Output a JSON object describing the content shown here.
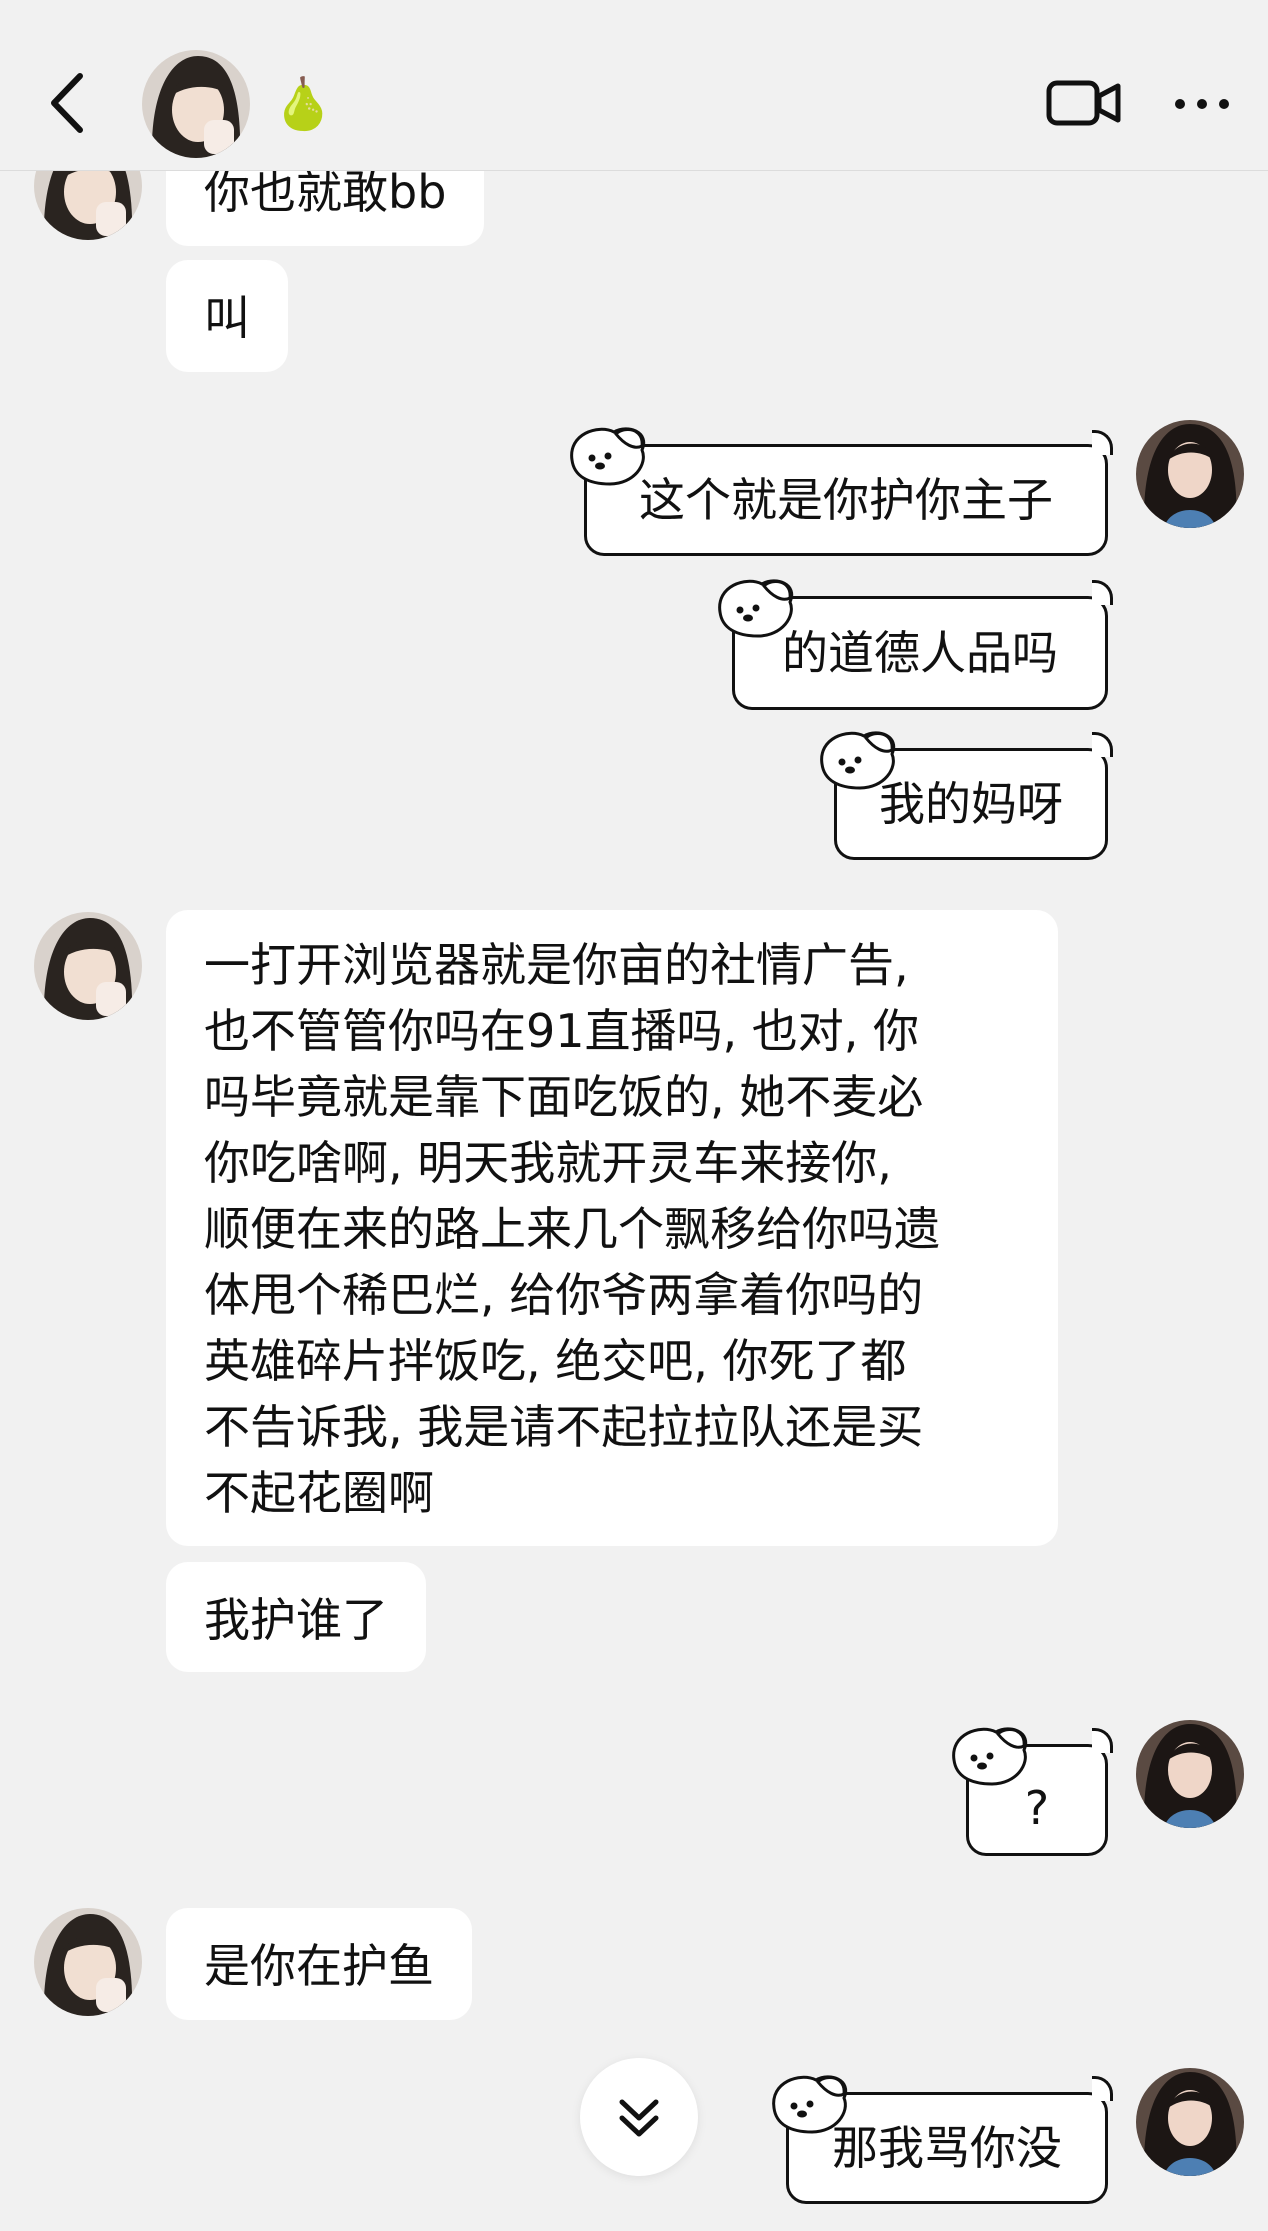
{
  "header": {
    "back_icon": "chevron-left-icon",
    "contact_emoji": "🍐",
    "video_icon": "video-camera-icon",
    "more_icon": "more-dots-icon"
  },
  "messages": [
    {
      "side": "in",
      "text": "你也就敢bb"
    },
    {
      "side": "in",
      "text": "叫"
    },
    {
      "side": "out",
      "text": "这个就是你护你主子"
    },
    {
      "side": "out",
      "text": "的道德人品吗"
    },
    {
      "side": "out",
      "text": "我的妈呀"
    },
    {
      "side": "in",
      "lines": [
        "一打开浏览器就是你亩的社情广告,",
        "也不管管你吗在91直播吗, 也对, 你",
        "吗毕竟就是靠下面吃饭的, 她不麦必",
        "你吃啥啊, 明天我就开灵车来接你,",
        "顺便在来的路上来几个飘移给你吗遗",
        "体甩个稀巴烂, 给你爷两拿着你吗的",
        "英雄碎片拌饭吃, 绝交吧, 你死了都",
        "不告诉我, 我是请不起拉拉队还是买",
        "不起花圈啊"
      ]
    },
    {
      "side": "in",
      "text": "我护谁了"
    },
    {
      "side": "out",
      "text": "?"
    },
    {
      "side": "in",
      "text": "是你在护鱼"
    },
    {
      "side": "out",
      "text": "那我骂你没"
    }
  ],
  "scroll_down_icon": "double-chevron-down-icon",
  "colors": {
    "background": "#f1f1f1",
    "bubble": "#ffffff",
    "outline": "#111111"
  }
}
